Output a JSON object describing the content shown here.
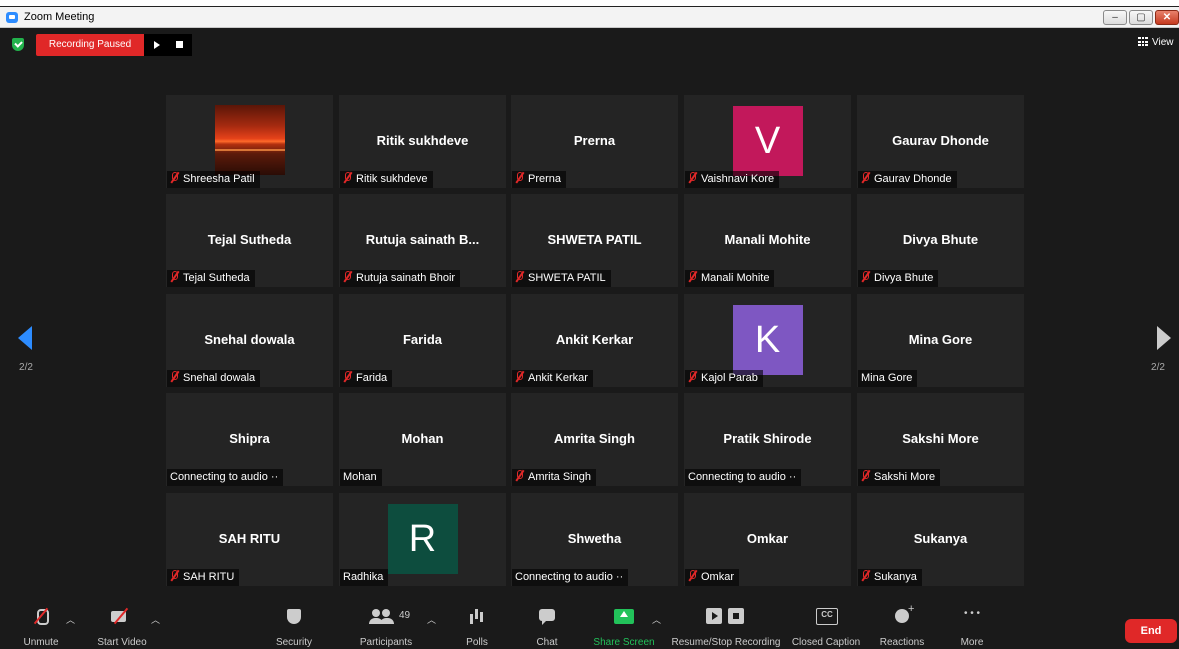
{
  "window": {
    "title": "Zoom Meeting"
  },
  "recording": {
    "status": "Recording Paused"
  },
  "view_label": "View",
  "pagination": {
    "left": "2/2",
    "right": "2/2"
  },
  "colors": {
    "accent": "#2d8cff",
    "recording": "#e02828",
    "share": "#22c25a",
    "avatar_v": "#c2185b",
    "avatar_k": "#7e57c2",
    "avatar_r": "#0d4d3e"
  },
  "participants": [
    {
      "display": "photo",
      "center": "",
      "label": "Shreesha Patil",
      "muted": true
    },
    {
      "display": "name",
      "center": "Ritik sukhdeve",
      "label": "Ritik sukhdeve",
      "muted": true
    },
    {
      "display": "name",
      "center": "Prerna",
      "label": "Prerna",
      "muted": true
    },
    {
      "display": "avatar",
      "center": "V",
      "label": "Vaishnavi Kore",
      "muted": true
    },
    {
      "display": "name",
      "center": "Gaurav Dhonde",
      "label": "Gaurav Dhonde",
      "muted": true
    },
    {
      "display": "name",
      "center": "Tejal Sutheda",
      "label": "Tejal Sutheda",
      "muted": true
    },
    {
      "display": "name",
      "center": "Rutuja sainath B...",
      "label": "Rutuja sainath Bhoir",
      "muted": true
    },
    {
      "display": "name",
      "center": "SHWETA PATIL",
      "label": "SHWETA PATIL",
      "muted": true
    },
    {
      "display": "name",
      "center": "Manali Mohite",
      "label": "Manali Mohite",
      "muted": true
    },
    {
      "display": "name",
      "center": "Divya Bhute",
      "label": "Divya Bhute",
      "muted": true
    },
    {
      "display": "name",
      "center": "Snehal dowala",
      "label": "Snehal dowala",
      "muted": true
    },
    {
      "display": "name",
      "center": "Farida",
      "label": "Farida",
      "muted": true
    },
    {
      "display": "name",
      "center": "Ankit Kerkar",
      "label": "Ankit Kerkar",
      "muted": true
    },
    {
      "display": "avatar",
      "center": "K",
      "label": "Kajol Parab",
      "muted": true
    },
    {
      "display": "name",
      "center": "Mina Gore",
      "label": "Mina Gore",
      "muted": false
    },
    {
      "display": "name",
      "center": "Shipra",
      "label": "Connecting to audio ··",
      "muted": false
    },
    {
      "display": "name",
      "center": "Mohan",
      "label": "Mohan",
      "muted": false
    },
    {
      "display": "name",
      "center": "Amrita Singh",
      "label": "Amrita Singh",
      "muted": true
    },
    {
      "display": "name",
      "center": "Pratik Shirode",
      "label": "Connecting to audio ··",
      "muted": false
    },
    {
      "display": "name",
      "center": "Sakshi More",
      "label": "Sakshi More",
      "muted": true
    },
    {
      "display": "name",
      "center": "SAH RITU",
      "label": "SAH RITU",
      "muted": true
    },
    {
      "display": "avatar",
      "center": "R",
      "label": "Radhika",
      "muted": false
    },
    {
      "display": "name",
      "center": "Shwetha",
      "label": "Connecting to audio ··",
      "muted": false
    },
    {
      "display": "name",
      "center": "Omkar",
      "label": "Omkar",
      "muted": true
    },
    {
      "display": "name",
      "center": "Sukanya",
      "label": "Sukanya",
      "muted": true
    }
  ],
  "toolbar": {
    "unmute": "Unmute",
    "start_video": "Start Video",
    "security": "Security",
    "participants": "Participants",
    "participants_count": "49",
    "polls": "Polls",
    "chat": "Chat",
    "share_screen": "Share Screen",
    "recording": "Resume/Stop Recording",
    "closed_caption": "Closed Caption",
    "reactions": "Reactions",
    "more": "More",
    "end": "End"
  }
}
